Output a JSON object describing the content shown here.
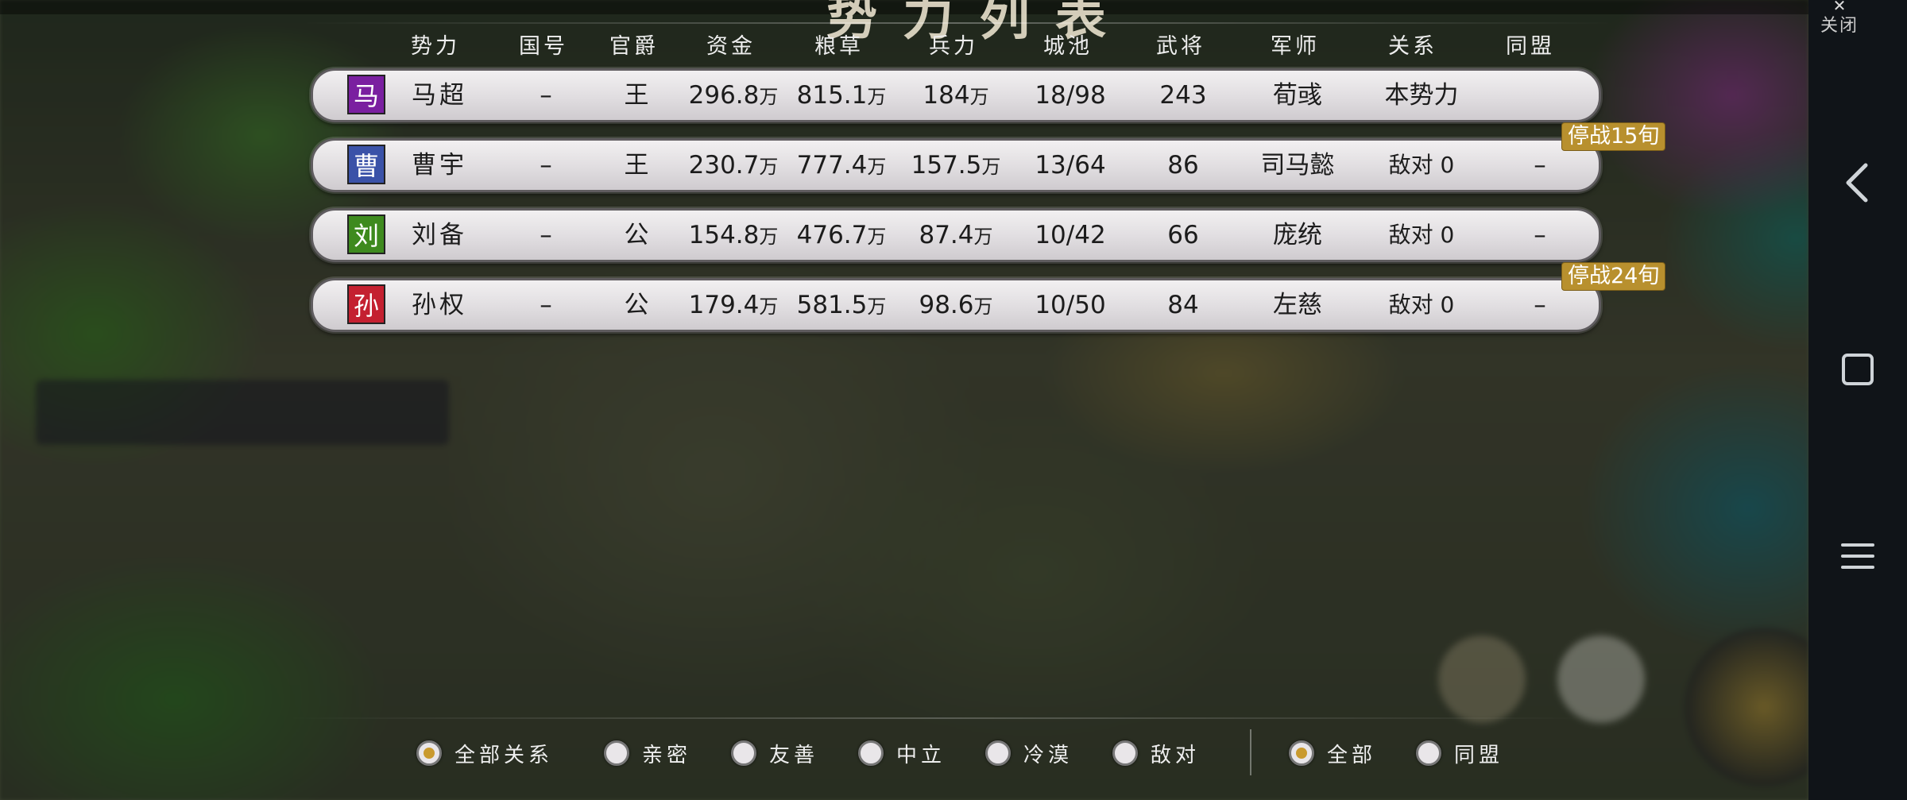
{
  "title_fragment": "势力列表",
  "close_button": {
    "label": "关闭"
  },
  "columns": [
    "势力",
    "国号",
    "官爵",
    "资金",
    "粮草",
    "兵力",
    "城池",
    "武将",
    "军师",
    "关系",
    "同盟"
  ],
  "factions": [
    {
      "badge": "马",
      "badge_color": "#7a1fa0",
      "name": "马超",
      "guohao": "–",
      "rank": "王",
      "funds": "296.8",
      "food": "815.1",
      "troops": "184",
      "cities": "18/98",
      "generals": "243",
      "advisor": "荀彧",
      "relation": "本势力",
      "alliance": "",
      "truce": ""
    },
    {
      "badge": "曹",
      "badge_color": "#3a52a8",
      "name": "曹宇",
      "guohao": "–",
      "rank": "王",
      "funds": "230.7",
      "food": "777.4",
      "troops": "157.5",
      "cities": "13/64",
      "generals": "86",
      "advisor": "司马懿",
      "relation": "敌对 0",
      "alliance": "–",
      "truce": "停战15旬"
    },
    {
      "badge": "刘",
      "badge_color": "#3e8a1e",
      "name": "刘备",
      "guohao": "–",
      "rank": "公",
      "funds": "154.8",
      "food": "476.7",
      "troops": "87.4",
      "cities": "10/42",
      "generals": "66",
      "advisor": "庞统",
      "relation": "敌对 0",
      "alliance": "–",
      "truce": ""
    },
    {
      "badge": "孙",
      "badge_color": "#c42030",
      "name": "孙权",
      "guohao": "–",
      "rank": "公",
      "funds": "179.4",
      "food": "581.5",
      "troops": "98.6",
      "cities": "10/50",
      "generals": "84",
      "advisor": "左慈",
      "relation": "敌对 0",
      "alliance": "–",
      "truce": "停战24旬"
    }
  ],
  "unit_wan": "万",
  "relation_filters": [
    {
      "label": "全部关系",
      "selected": true
    },
    {
      "label": "亲密",
      "selected": false
    },
    {
      "label": "友善",
      "selected": false
    },
    {
      "label": "中立",
      "selected": false
    },
    {
      "label": "冷漠",
      "selected": false
    },
    {
      "label": "敌对",
      "selected": false
    }
  ],
  "alliance_filters": [
    {
      "label": "全部",
      "selected": true
    },
    {
      "label": "同盟",
      "selected": false
    }
  ],
  "colors": {
    "accent_gold": "#c99a2e",
    "truce_badge": "#b8902e",
    "row_bg": "#e6e3e6"
  },
  "nav_icons": [
    "back-icon",
    "recent-apps-icon",
    "menu-icon"
  ]
}
